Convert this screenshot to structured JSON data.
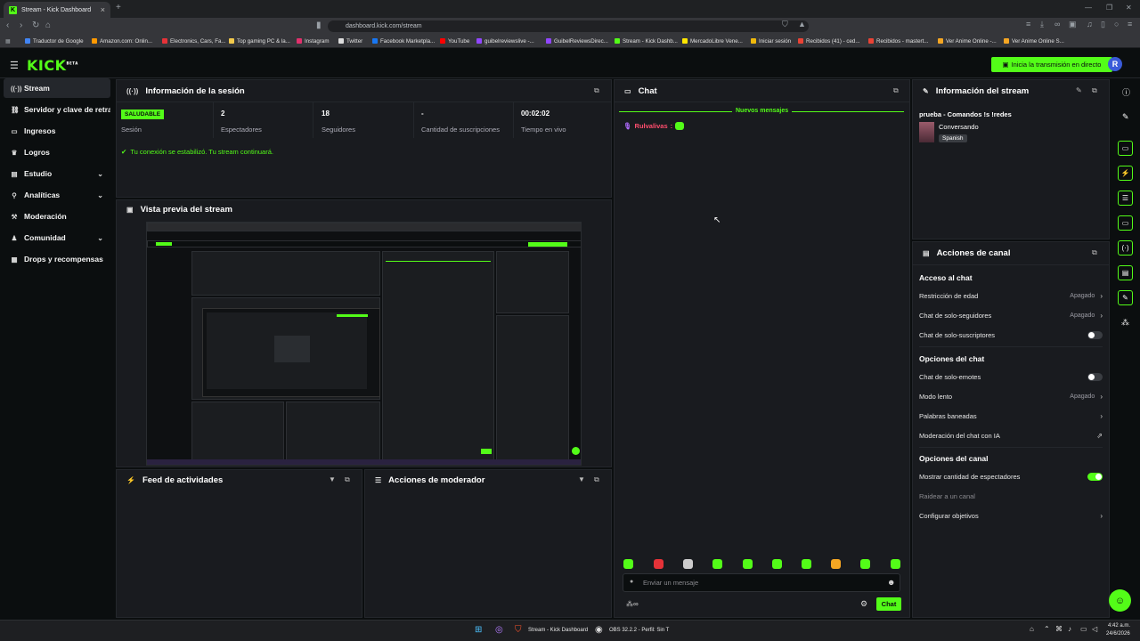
{
  "browser": {
    "tab_title": "Stream - Kick Dashboard",
    "url": "dashboard.kick.com/stream",
    "bookmarks": [
      {
        "label": "Traductor de Google",
        "color": "#4285f4"
      },
      {
        "label": "Amazon.com: Onlin...",
        "color": "#ff9900"
      },
      {
        "label": "Electronics, Cars, Fa...",
        "color": "#e53238"
      },
      {
        "label": "Top gaming PC & la...",
        "color": "#f2c94c"
      },
      {
        "label": "Instagram",
        "color": "#e1306c"
      },
      {
        "label": "Twitter",
        "color": "#dddddd"
      },
      {
        "label": "Facebook Marketpla...",
        "color": "#1877f2"
      },
      {
        "label": "YouTube",
        "color": "#ff0000"
      },
      {
        "label": "guibelreviewslive -...",
        "color": "#9146ff"
      },
      {
        "label": "GuibelReviewsDirec...",
        "color": "#9146ff"
      },
      {
        "label": "Stream - Kick Dashb...",
        "color": "#53fc18"
      },
      {
        "label": "MercadoLibre Vene...",
        "color": "#ffe600"
      },
      {
        "label": "Iniciar sesión",
        "color": "#f0b90b"
      },
      {
        "label": "Recibidos (41) - ced...",
        "color": "#ea4335"
      },
      {
        "label": "Recibidos - mastert...",
        "color": "#ea4335"
      },
      {
        "label": "Ver Anime Online -...",
        "color": "#f5a623"
      },
      {
        "label": "Ver Anime Online S...",
        "color": "#f5a623"
      }
    ]
  },
  "header": {
    "logo": "KICK",
    "logo_beta": "BETA",
    "go_live_label": "Inicia la transmisión en directo",
    "avatar_letter": "R"
  },
  "sidebar": {
    "items": [
      {
        "label": "Stream",
        "icon": "radio-icon",
        "active": true
      },
      {
        "label": "Servidor y clave de retransmisión",
        "icon": "link-icon"
      },
      {
        "label": "Ingresos",
        "icon": "money-icon"
      },
      {
        "label": "Logros",
        "icon": "trophy-icon"
      },
      {
        "label": "Estudio",
        "icon": "studio-icon",
        "expandable": true
      },
      {
        "label": "Analíticas",
        "icon": "analytics-icon",
        "expandable": true
      },
      {
        "label": "Moderación",
        "icon": "hammer-icon"
      },
      {
        "label": "Comunidad",
        "icon": "community-icon",
        "expandable": true
      },
      {
        "label": "Drops y recompensas",
        "icon": "gift-icon"
      }
    ]
  },
  "session": {
    "title": "Información de la sesión",
    "health_badge": "SALUDABLE",
    "health_label": "Sesión",
    "viewers_value": "2",
    "viewers_label": "Espectadores",
    "followers_value": "18",
    "followers_label": "Seguidores",
    "subs_value": "-",
    "subs_label": "Cantidad de suscripciones",
    "live_time_value": "00:02:02",
    "live_time_label": "Tiempo en vivo",
    "status_message": "Tu conexión se estabilizó. Tu stream continuará."
  },
  "preview": {
    "title": "Vista previa del stream"
  },
  "activity": {
    "title": "Feed de actividades"
  },
  "mod_actions": {
    "title": "Acciones de moderador"
  },
  "chat": {
    "title": "Chat",
    "new_messages": "Nuevos mensajes",
    "message_user": "Rulvalivas",
    "input_placeholder": "Enviar un mensaje",
    "send_label": "Chat",
    "emote_colors": [
      "#53fc18",
      "#e53238",
      "#cccccc",
      "#53fc18",
      "#53fc18",
      "#53fc18",
      "#53fc18",
      "#f5a623",
      "#53fc18",
      "#53fc18"
    ]
  },
  "stream_info": {
    "title": "Información del stream",
    "stream_title": "prueba - Comandos !s !redes",
    "category": "Conversando",
    "language": "Spanish"
  },
  "channel_actions": {
    "title": "Acciones de canal",
    "chat_access": "Acceso al chat",
    "age_restriction": "Restricción de edad",
    "age_restriction_value": "Apagado",
    "followers_only": "Chat de solo-seguidores",
    "followers_only_value": "Apagado",
    "subs_only": "Chat de solo-suscriptores",
    "chat_options": "Opciones del chat",
    "emotes_only": "Chat de solo-emotes",
    "slow_mode": "Modo lento",
    "slow_mode_value": "Apagado",
    "banned_words": "Palabras baneadas",
    "ai_moderation": "Moderación del chat con IA",
    "channel_options": "Opciones del canal",
    "show_viewers": "Mostrar cantidad de espectadores",
    "raid": "Raidear a un canal",
    "goals": "Configurar objetivos"
  },
  "taskbar": {
    "item1": "Stream - Kick Dashboard",
    "item2": "OBS 32.2.2 - Perfil: Sin T",
    "time": "4:42 a.m.",
    "date": "24/6/2026"
  }
}
